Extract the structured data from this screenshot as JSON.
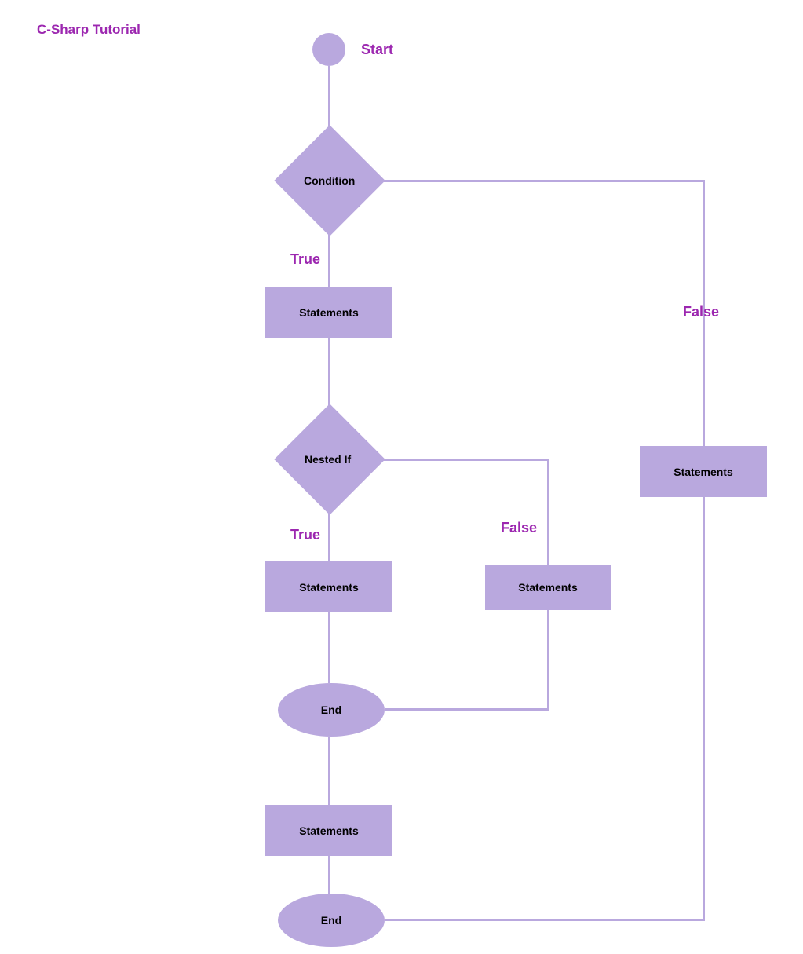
{
  "title": "C-Sharp Tutorial",
  "nodes": {
    "start": "Start",
    "condition": "Condition",
    "nested_if": "Nested If",
    "statements": "Statements",
    "end": "End"
  },
  "edges": {
    "true": "True",
    "false": "False"
  },
  "flowchart": {
    "description": "Flowchart of a nested if statement",
    "structure": [
      {
        "from": "Start",
        "to": "Condition"
      },
      {
        "from": "Condition",
        "label": "True",
        "to": "Statements (outer true block)"
      },
      {
        "from": "Condition",
        "label": "False",
        "to": "Statements (outer false/else block)"
      },
      {
        "from": "Statements (outer true block)",
        "to": "Nested If"
      },
      {
        "from": "Nested If",
        "label": "True",
        "to": "Statements (nested true block)"
      },
      {
        "from": "Nested If",
        "label": "False",
        "to": "Statements (nested false/else block)"
      },
      {
        "from": "Statements (nested true block)",
        "to": "End (inner)"
      },
      {
        "from": "Statements (nested false/else block)",
        "to": "End (inner)"
      },
      {
        "from": "End (inner)",
        "to": "Statements (after nested if)"
      },
      {
        "from": "Statements (after nested if)",
        "to": "End (outer)"
      },
      {
        "from": "Statements (outer false/else block)",
        "to": "End (outer)"
      }
    ]
  },
  "colors": {
    "shape_fill": "#b9a8de",
    "accent_text": "#9c27b0",
    "node_text": "#000000"
  }
}
